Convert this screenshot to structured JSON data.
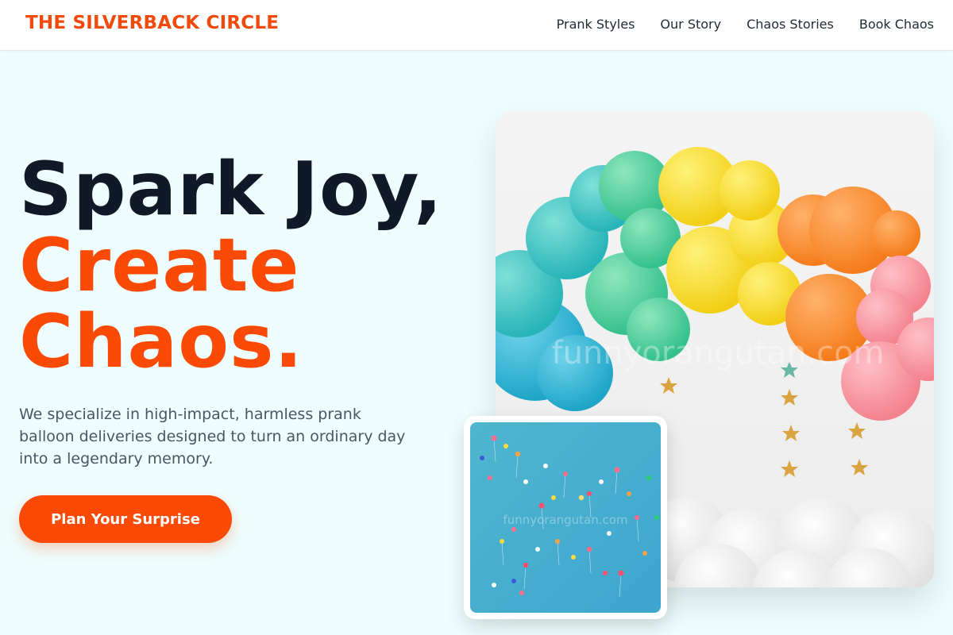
{
  "header": {
    "logo": "THE SILVERBACK CIRCLE",
    "nav": [
      "Prank Styles",
      "Our Story",
      "Chaos Stories",
      "Book Chaos"
    ]
  },
  "hero": {
    "title_line1": "Spark Joy,",
    "title_line2": "Create",
    "title_line3": "Chaos.",
    "description": "We specialize in high-impact, harmless prank balloon deliveries designed to turn an ordinary day into a legendary memory.",
    "cta_label": "Plan Your Surprise"
  },
  "images": {
    "main_watermark": "funnyorangutan.com",
    "small_watermark": "funnyorangutan.com"
  },
  "colors": {
    "brand": "#fa4a05",
    "background": "#eefefe",
    "heading": "#111827"
  }
}
